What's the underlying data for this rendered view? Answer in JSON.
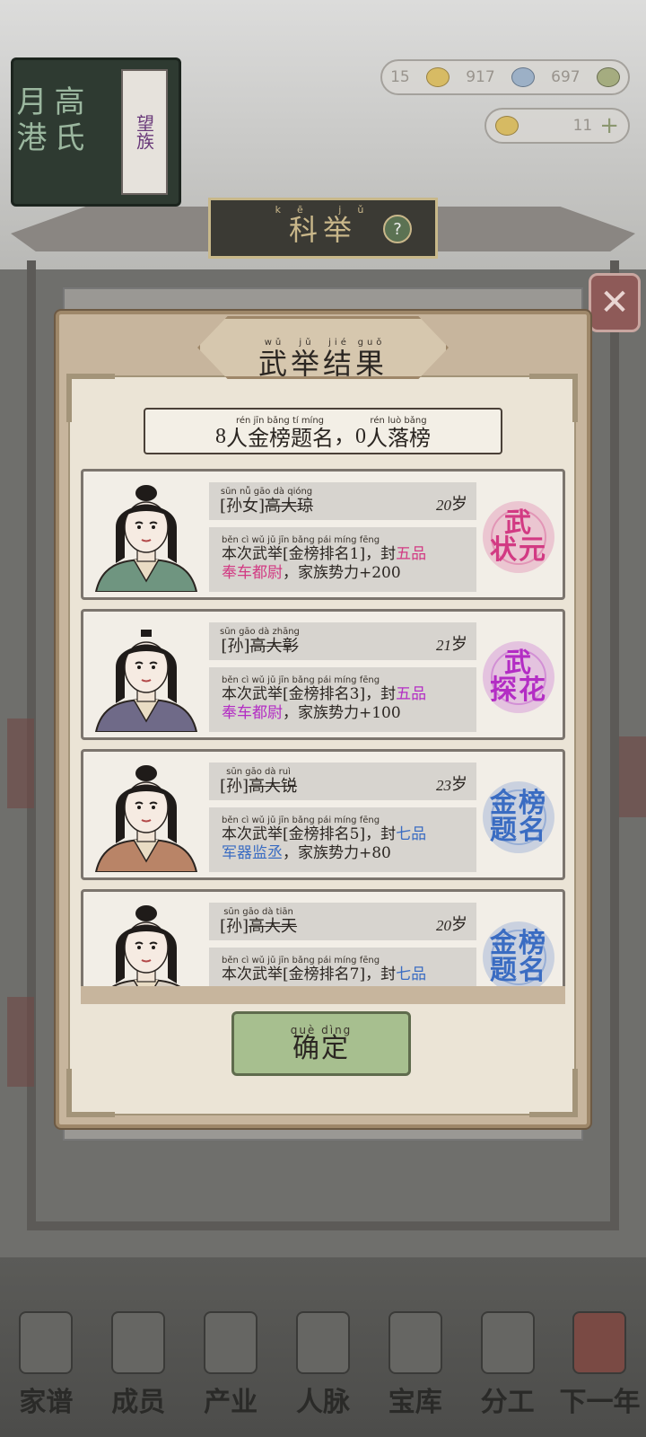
{
  "game": {
    "clan_plaque": {
      "text_1": "月港",
      "text_2": "高氏",
      "tag": "望族"
    },
    "resources": {
      "r1": "15",
      "r2": "917",
      "r3": "697",
      "r4": "11"
    },
    "hall_banner": {
      "title": "科举",
      "pinyin": "kē jǔ"
    },
    "help_symbol": "?",
    "close_symbol": "✕",
    "dock": [
      "家谱",
      "成员",
      "产业",
      "人脉",
      "宝库",
      "分工",
      "下一年"
    ]
  },
  "modal": {
    "title": "武举结果",
    "title_pinyin": [
      "wǔ",
      "jǔ",
      "jié",
      "guǒ"
    ],
    "summary": {
      "passed_count": "8",
      "passed_label": "人金榜题名",
      "separator": "，",
      "failed_count": "0",
      "failed_label": "人落榜",
      "pinyin_passed": "rén jīn bǎng tí míng",
      "pinyin_failed": "rén luò bǎng"
    },
    "results": [
      {
        "relation": "孙女",
        "name": "高大琼",
        "age": "20",
        "age_unit": "岁",
        "rank": "1",
        "official_rank": "五品",
        "office": "奉车都尉",
        "influence": "+200",
        "stamp": [
          "武",
          "状元"
        ],
        "stamp_color": "#d23a83",
        "name_pinyin": "sūn nǚ gāo dà qióng"
      },
      {
        "relation": "孙",
        "name": "高大彰",
        "age": "21",
        "age_unit": "岁",
        "rank": "3",
        "official_rank": "五品",
        "office": "奉车都尉",
        "influence": "+100",
        "stamp": [
          "武",
          "探花"
        ],
        "stamp_color": "#b32dc4",
        "name_pinyin": "sūn gāo dà zhāng"
      },
      {
        "relation": "孙",
        "name": "高大锐",
        "age": "23",
        "age_unit": "岁",
        "rank": "5",
        "official_rank": "七品",
        "office": "军器监丞",
        "influence": "+80",
        "stamp": [
          "金榜",
          "题名"
        ],
        "stamp_color": "#3a6cc2",
        "name_pinyin": "sūn gāo dà ruì"
      },
      {
        "relation": "孙",
        "name": "高大天",
        "age": "20",
        "age_unit": "岁",
        "rank": "7",
        "official_rank": "七品",
        "office": "",
        "influence": "",
        "stamp": [
          "金榜",
          "题名"
        ],
        "stamp_color": "#3a6cc2",
        "name_pinyin": "sūn gāo dà tiān"
      }
    ],
    "desc_template": {
      "prefix": "本次武举[金榜排名",
      "middle": "]，封",
      "suffix": "，家族势力",
      "pinyin": "běn cì wǔ jǔ  jīn bǎng pái míng  fēng"
    },
    "confirm": {
      "label": "确定",
      "pinyin": "què dìng"
    }
  }
}
